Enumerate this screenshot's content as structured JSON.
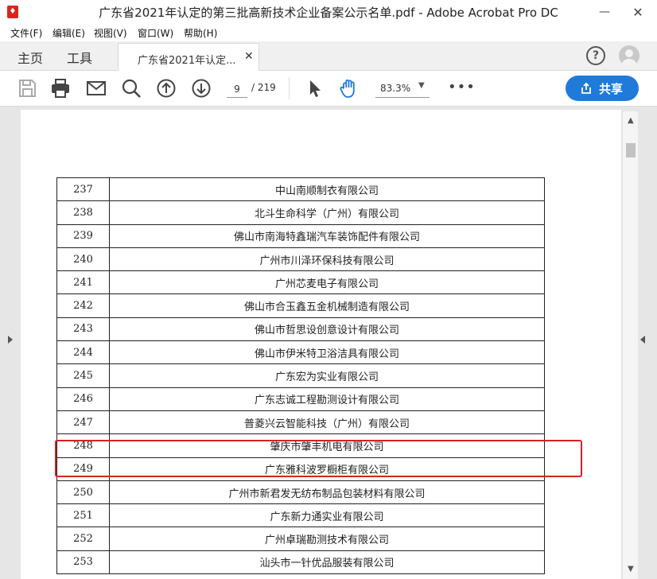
{
  "window": {
    "title": "广东省2021年认定的第三批高新技术企业备案公示名单.pdf - Adobe Acrobat Pro DC",
    "minimize_glyph": "—",
    "close_glyph": "✕",
    "app_icon": "pdf-icon"
  },
  "menu": [
    "文件(F)",
    "编辑(E)",
    "视图(V)",
    "窗口(W)",
    "帮助(H)"
  ],
  "tabs": {
    "home": "主页",
    "tools": "工具",
    "document": "广东省2021年认定...",
    "close_glyph": "✕",
    "help_glyph": "?"
  },
  "toolbar": {
    "icons": [
      "save-icon",
      "print-icon",
      "email-icon",
      "search-icon",
      "page-up-icon",
      "page-down-icon",
      "select-cursor-icon",
      "hand-tool-icon"
    ],
    "page_current": "9",
    "page_total": "/ 219",
    "zoom": "83.3%",
    "zoom_caret": "▼",
    "more": "•••",
    "share_label": "共享"
  },
  "scroll": {
    "up": "▲",
    "down": "▼"
  },
  "colors": {
    "accent": "#1f7ad9",
    "highlight": "#d32222"
  },
  "table": {
    "rows": [
      {
        "num": "237",
        "name": "中山南顺制衣有限公司"
      },
      {
        "num": "238",
        "name": "北斗生命科学（广州）有限公司"
      },
      {
        "num": "239",
        "name": "佛山市南海特鑫瑞汽车装饰配件有限公司"
      },
      {
        "num": "240",
        "name": "广州市川泽环保科技有限公司"
      },
      {
        "num": "241",
        "name": "广州芯麦电子有限公司"
      },
      {
        "num": "242",
        "name": "佛山市合玉鑫五金机械制造有限公司"
      },
      {
        "num": "243",
        "name": "佛山市哲思设创意设计有限公司"
      },
      {
        "num": "244",
        "name": "佛山市伊米特卫浴洁具有限公司"
      },
      {
        "num": "245",
        "name": "广东宏为实业有限公司"
      },
      {
        "num": "246",
        "name": "广东志诚工程勘测设计有限公司"
      },
      {
        "num": "247",
        "name": "普菱兴云智能科技（广州）有限公司"
      },
      {
        "num": "248",
        "name": "肇庆市肇丰机电有限公司"
      },
      {
        "num": "249",
        "name": "广东雅科波罗橱柜有限公司"
      },
      {
        "num": "250",
        "name": "广州市新君发无纺布制品包装材料有限公司"
      },
      {
        "num": "251",
        "name": "广东新力通实业有限公司"
      },
      {
        "num": "252",
        "name": "广州卓瑞勘测技术有限公司"
      },
      {
        "num": "253",
        "name": "汕头市一针优品服装有限公司"
      }
    ]
  }
}
